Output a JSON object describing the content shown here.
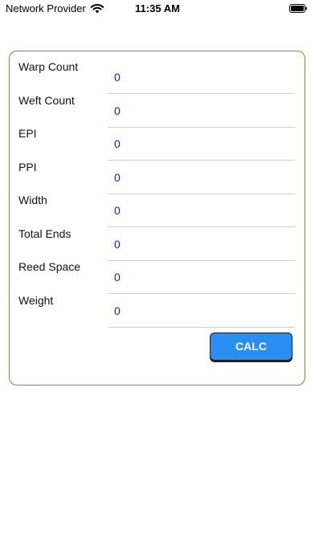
{
  "status_bar": {
    "carrier": "Network Provider",
    "time": "11:35 AM"
  },
  "form": {
    "fields": [
      {
        "label": "Warp Count",
        "value": "0"
      },
      {
        "label": "Weft Count",
        "value": "0"
      },
      {
        "label": "EPI",
        "value": "0"
      },
      {
        "label": "PPI",
        "value": "0"
      },
      {
        "label": "Width",
        "value": "0"
      },
      {
        "label": "Total Ends",
        "value": "0"
      },
      {
        "label": "Reed Space",
        "value": "0"
      },
      {
        "label": "Weight",
        "value": "0"
      }
    ],
    "calc_label": "CALC"
  },
  "colors": {
    "card_border": "#8a8630",
    "value_text": "#1a17e0",
    "button_bg": "#2a8ff0"
  },
  "icons": [
    "wifi-icon",
    "battery-icon"
  ]
}
